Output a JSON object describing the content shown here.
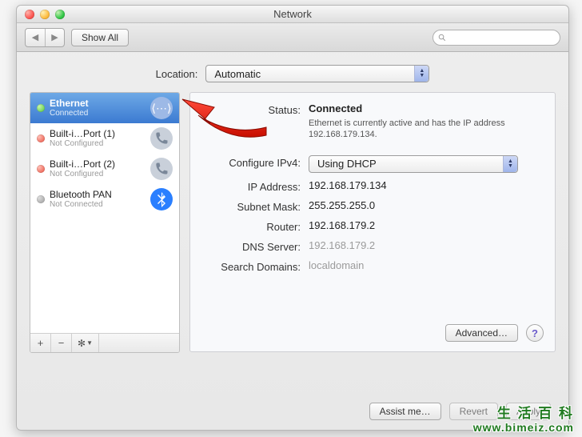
{
  "window": {
    "title": "Network"
  },
  "toolbar": {
    "show_all": "Show All"
  },
  "location": {
    "label": "Location:",
    "value": "Automatic"
  },
  "sidebar": {
    "items": [
      {
        "name": "Ethernet",
        "status": "Connected",
        "dot": "green",
        "icon": "ethernet",
        "selected": true
      },
      {
        "name": "Built-i…Port (1)",
        "status": "Not Configured",
        "dot": "red",
        "icon": "phone",
        "selected": false
      },
      {
        "name": "Built-i…Port (2)",
        "status": "Not Configured",
        "dot": "red",
        "icon": "phone",
        "selected": false
      },
      {
        "name": "Bluetooth PAN",
        "status": "Not Connected",
        "dot": "grey",
        "icon": "bluetooth",
        "selected": false
      }
    ],
    "footer_buttons": [
      "+",
      "−",
      "✻▾"
    ]
  },
  "detail": {
    "labels": {
      "status": "Status:",
      "configure_ipv4": "Configure IPv4:",
      "ip_address": "IP Address:",
      "subnet_mask": "Subnet Mask:",
      "router": "Router:",
      "dns_server": "DNS Server:",
      "search_domains": "Search Domains:"
    },
    "status_value": "Connected",
    "status_note": "Ethernet is currently active and has the IP address 192.168.179.134.",
    "configure_ipv4_value": "Using DHCP",
    "ip_address": "192.168.179.134",
    "subnet_mask": "255.255.255.0",
    "router": "192.168.179.2",
    "dns_server": "192.168.179.2",
    "search_domains": "localdomain",
    "advanced": "Advanced…"
  },
  "footer": {
    "assist": "Assist me…",
    "revert": "Revert",
    "apply": "Apply"
  },
  "watermark": {
    "line1": "生 活 百 科",
    "line2": "www.bimeiz.com"
  }
}
